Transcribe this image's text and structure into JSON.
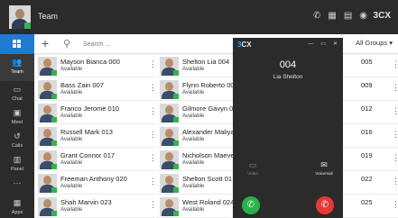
{
  "topbar": {
    "title": "Team",
    "icons": [
      "phone-icon",
      "voicemail-icon",
      "contacts-icon",
      "chat-icon"
    ],
    "brand": "3CX"
  },
  "sidebar": {
    "items": [
      {
        "label": "Team",
        "icon": "team-icon"
      },
      {
        "label": "Chat",
        "icon": "chat-icon"
      },
      {
        "label": "Meet",
        "icon": "meet-icon"
      },
      {
        "label": "Calls",
        "icon": "calls-icon"
      },
      {
        "label": "Panel",
        "icon": "panel-icon"
      },
      {
        "label": "",
        "icon": "more-icon"
      },
      {
        "label": "Apps",
        "icon": "apps-icon"
      }
    ]
  },
  "toolbar": {
    "search_placeholder": "Search ...",
    "groups_label": "All Groups ▾"
  },
  "contacts": {
    "col1": [
      {
        "name": "Mayson Bianca 000",
        "status": "Available"
      },
      {
        "name": "Bass Zain 007",
        "status": "Available"
      },
      {
        "name": "Franco Jerome 010",
        "status": "Available"
      },
      {
        "name": "Russell Mark 013",
        "status": "Available"
      },
      {
        "name": "Grant Connor 017",
        "status": "Available"
      },
      {
        "name": "Freeman Anthony 020",
        "status": "Available"
      },
      {
        "name": "Shah Marvin 023",
        "status": "Available"
      }
    ],
    "col2": [
      {
        "name": "Shelton Lia 004",
        "status": "Available"
      },
      {
        "name": "Flynn Roberto 00",
        "status": "Available"
      },
      {
        "name": "Gilmore Gavyn 0",
        "status": "Available"
      },
      {
        "name": "Alexander Maliya",
        "status": "Available"
      },
      {
        "name": "Nicholson Maeve",
        "status": "Available"
      },
      {
        "name": "Shelton Scott 01",
        "status": "Available"
      },
      {
        "name": "West Roland 024",
        "status": "Available"
      }
    ],
    "col3": [
      {
        "name": "005"
      },
      {
        "name": "009"
      },
      {
        "name": "012"
      },
      {
        "name": "016"
      },
      {
        "name": "019"
      },
      {
        "name": "022"
      },
      {
        "name": "025"
      }
    ]
  },
  "call": {
    "logo_prefix": "3",
    "logo_suffix": "CX",
    "window_controls": [
      "—",
      "▭",
      "✕"
    ],
    "extension": "004",
    "caller": "Lia Shelton",
    "video_label": "Video",
    "voicemail_label": "Voicemail",
    "colors": {
      "answer": "#28b24a",
      "decline": "#e53935",
      "available": "#35b24a",
      "accent": "#1f7ad6"
    }
  }
}
